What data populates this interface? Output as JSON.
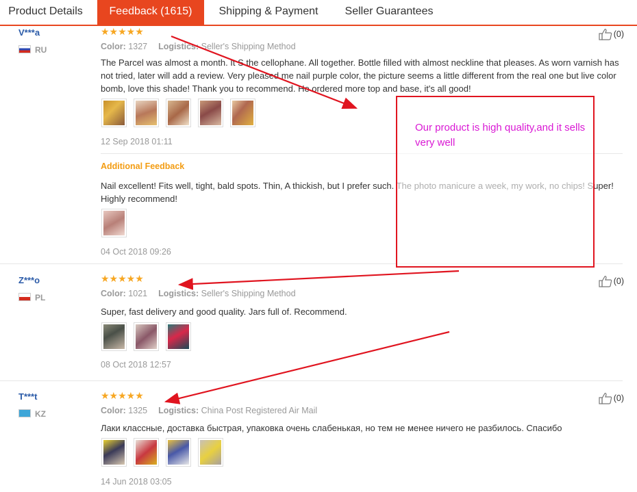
{
  "tabs": [
    {
      "label": "Product Details",
      "active": false
    },
    {
      "label": "Feedback (1615)",
      "active": true
    },
    {
      "label": "Shipping & Payment",
      "active": false
    },
    {
      "label": "Seller Guarantees",
      "active": false
    }
  ],
  "labels": {
    "color": "Color:",
    "logistics": "Logistics:",
    "additional_feedback": "Additional Feedback"
  },
  "reviews": [
    {
      "user": "V***a",
      "country": "RU",
      "stars": "★★★★★",
      "rating": 5,
      "color": "1327",
      "logistics": "Seller's Shipping Method",
      "text": "The Parcel was almost a month. It  S the cellophane. All together. Bottle filled with almost neckline that pleases. As worn varnish has not tried, later will add a review. Very pleased me nail purple color, the picture seems a little different from the real one but live color bomb, love this shade! Thank you to recommend. He ordered more top and base, it's all good!",
      "date": "12 Sep 2018 01:11",
      "likes": "(0)",
      "additional": {
        "text": "Nail excellent! Fits well, tight, bald spots. Thin, A thickish, but I prefer such. The photo manicure a week, my work, no chips! Super! Highly recommend!",
        "date": "04 Oct 2018 09:26"
      }
    },
    {
      "user": "Z***o",
      "country": "PL",
      "stars": "★★★★★",
      "rating": 5,
      "color": "1021",
      "logistics": "Seller's Shipping Method",
      "text": "Super, fast delivery and good quality. Jars full of. Recommend.",
      "date": "08 Oct 2018 12:57",
      "likes": "(0)"
    },
    {
      "user": "T***t",
      "country": "KZ",
      "stars": "★★★★★",
      "rating": 5,
      "color": "1325",
      "logistics": "China Post Registered Air Mail",
      "text": "Лаки классные, доставка быстрая, упаковка очень слабенькая, но тем не менее ничего не разбилось. Спасибо",
      "date": "14 Jun 2018 03:05",
      "likes": "(0)"
    }
  ],
  "callout": {
    "text": "Our product is high quality,and it sells very well"
  },
  "colors": {
    "accent": "#e8461f",
    "star": "#f7a723",
    "link": "#2b5ba8",
    "annotation_red": "#e0141f",
    "annotation_text": "#d918d4",
    "additional_label": "#f39c12"
  }
}
